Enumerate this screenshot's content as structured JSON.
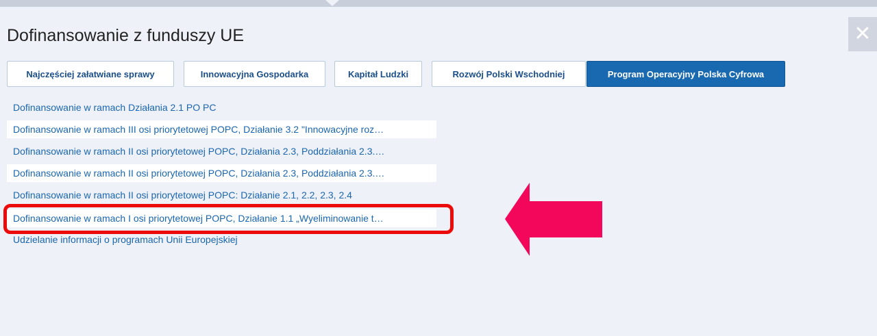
{
  "dialog": {
    "title": "Dofinansowanie z funduszy UE",
    "close_label": "✕"
  },
  "tabs": [
    {
      "label": "Najczęściej załatwiane sprawy",
      "active": false
    },
    {
      "label": "Innowacyjna Gospodarka",
      "active": false
    },
    {
      "label": "Kapitał Ludzki",
      "active": false
    },
    {
      "label": "Rozwój Polski Wschodniej",
      "active": false
    },
    {
      "label": "Program Operacyjny Polska Cyfrowa",
      "active": true
    }
  ],
  "links": [
    {
      "text": "Dofinansowanie w ramach Działania 2.1 PO PC"
    },
    {
      "text": "Dofinansowanie w ramach III osi priorytetowej POPC, Działanie 3.2 \"Innowacyjne roz…"
    },
    {
      "text": "Dofinansowanie w ramach II osi priorytetowej POPC, Działania 2.3, Poddziałania 2.3.…"
    },
    {
      "text": "Dofinansowanie w ramach II osi priorytetowej POPC, Działania 2.3, Poddziałania 2.3.…"
    },
    {
      "text": "Dofinansowanie w ramach II osi priorytetowej POPC: Działanie 2.1, 2.2, 2.3, 2.4"
    },
    {
      "text": "Dofinansowanie w ramach I osi priorytetowej POPC, Działanie 1.1 „Wyeliminowanie t…"
    },
    {
      "text": "Udzielanie informacji o programach Unii Europejskiej"
    }
  ],
  "colors": {
    "accent": "#1869b0",
    "link": "#1a66b0",
    "highlight_border": "#ec0b0b",
    "arrow": "#f2075a"
  },
  "annotation": {
    "highlighted_link_index": 5
  }
}
